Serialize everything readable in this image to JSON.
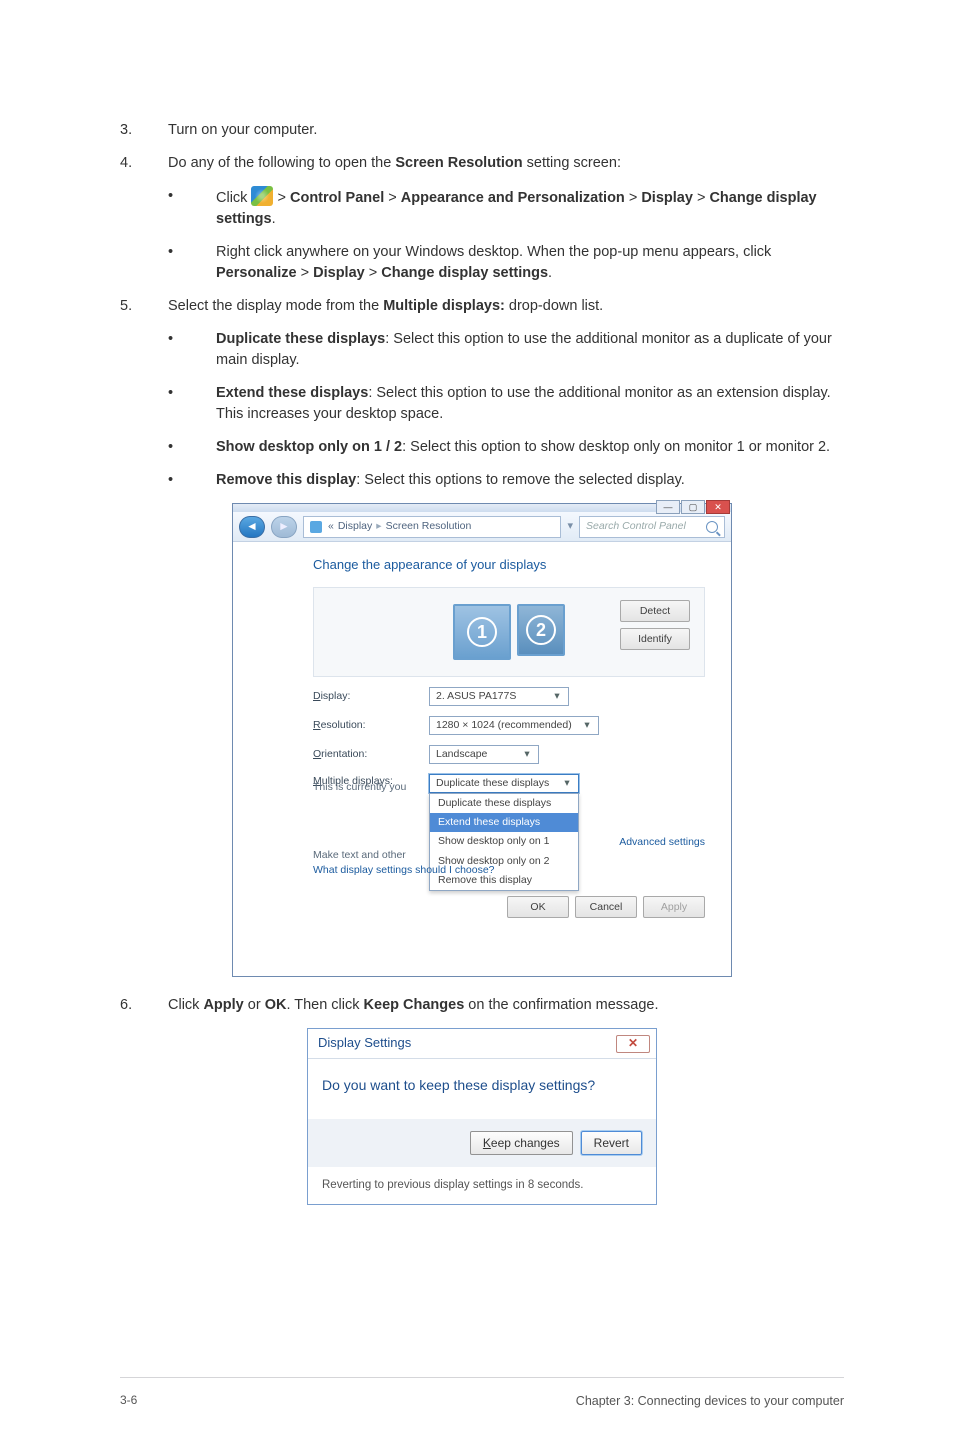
{
  "steps": {
    "s3": {
      "num": "3.",
      "text": "Turn on your computer."
    },
    "s4": {
      "num": "4.",
      "intro_a": "Do any of the following to open the ",
      "intro_b": "Screen Resolution",
      "intro_c": " setting screen:",
      "b1": {
        "pre": "Click ",
        "t1": " > ",
        "cp": "Control Panel",
        "t2": " > ",
        "ap": "Appearance and Personalization",
        "t3": " > ",
        "dp": "Display",
        "t4": " > ",
        "cd": "Change display settings",
        "dot": "."
      },
      "b2": {
        "a": "Right click anywhere on your Windows desktop. When the pop-up menu appears, click ",
        "p": "Personalize",
        "s1": " > ",
        "d": "Display",
        "s2": " > ",
        "c": "Change display settings",
        "dot": "."
      }
    },
    "s5": {
      "num": "5.",
      "intro_a": "Select the display mode from the ",
      "intro_b": "Multiple displays:",
      "intro_c": " drop-down list.",
      "b1": {
        "h": "Duplicate these displays",
        "t": ": Select this option to use the additional monitor as a duplicate of your main display."
      },
      "b2": {
        "h": "Extend these displays",
        "t": ": Select this option to use the additional monitor as an extension display. This increases your desktop space."
      },
      "b3": {
        "h": "Show desktop only on 1 / 2",
        "t": ": Select this option to show desktop only on monitor 1 or monitor 2."
      },
      "b4": {
        "h": "Remove this display",
        "t": ": Select this options to remove the selected display."
      }
    },
    "s6": {
      "num": "6.",
      "a": "Click ",
      "b": "Apply",
      "c": " or ",
      "d": "OK",
      "e": ". Then click ",
      "f": "Keep Changes",
      "g": " on the confirmation message."
    }
  },
  "screenres": {
    "path_a": "Display",
    "path_sep": "▸",
    "path_b": "Screen Resolution",
    "search_ph": "Search Control Panel",
    "heading": "Change the appearance of your displays",
    "mon1": "1",
    "mon2": "2",
    "btn_detect": "Detect",
    "btn_identify": "Identify",
    "lbl_display": "Display:",
    "val_display": "2. ASUS PA177S",
    "lbl_res": "Resolution:",
    "val_res": "1280 × 1024 (recommended)",
    "lbl_orient": "Orientation:",
    "val_orient": "Landscape",
    "lbl_multi": "Multiple displays:",
    "val_multi": "Duplicate these displays",
    "menu_opt_dup": "Duplicate these displays",
    "menu_opt_ext": "Extend these displays",
    "menu_opt_s1": "Show desktop only on 1",
    "menu_opt_s2": "Show desktop only on 2",
    "menu_opt_rm": "Remove this display",
    "hint_main": "This is currently you",
    "hint_make": "Make text and other",
    "link_what": "What display settings should I choose?",
    "link_adv": "Advanced settings",
    "btn_ok": "OK",
    "btn_cancel": "Cancel",
    "btn_apply": "Apply"
  },
  "dispset": {
    "title": "Display Settings",
    "question": "Do you want to keep these display settings?",
    "btn_keep": "Keep changes",
    "btn_revert": "Revert",
    "footer": "Reverting to previous display settings in 8 seconds."
  },
  "footer": {
    "page": "3-6",
    "chapter": "Chapter 3: Connecting devices to your computer"
  },
  "bullet_char": "•"
}
